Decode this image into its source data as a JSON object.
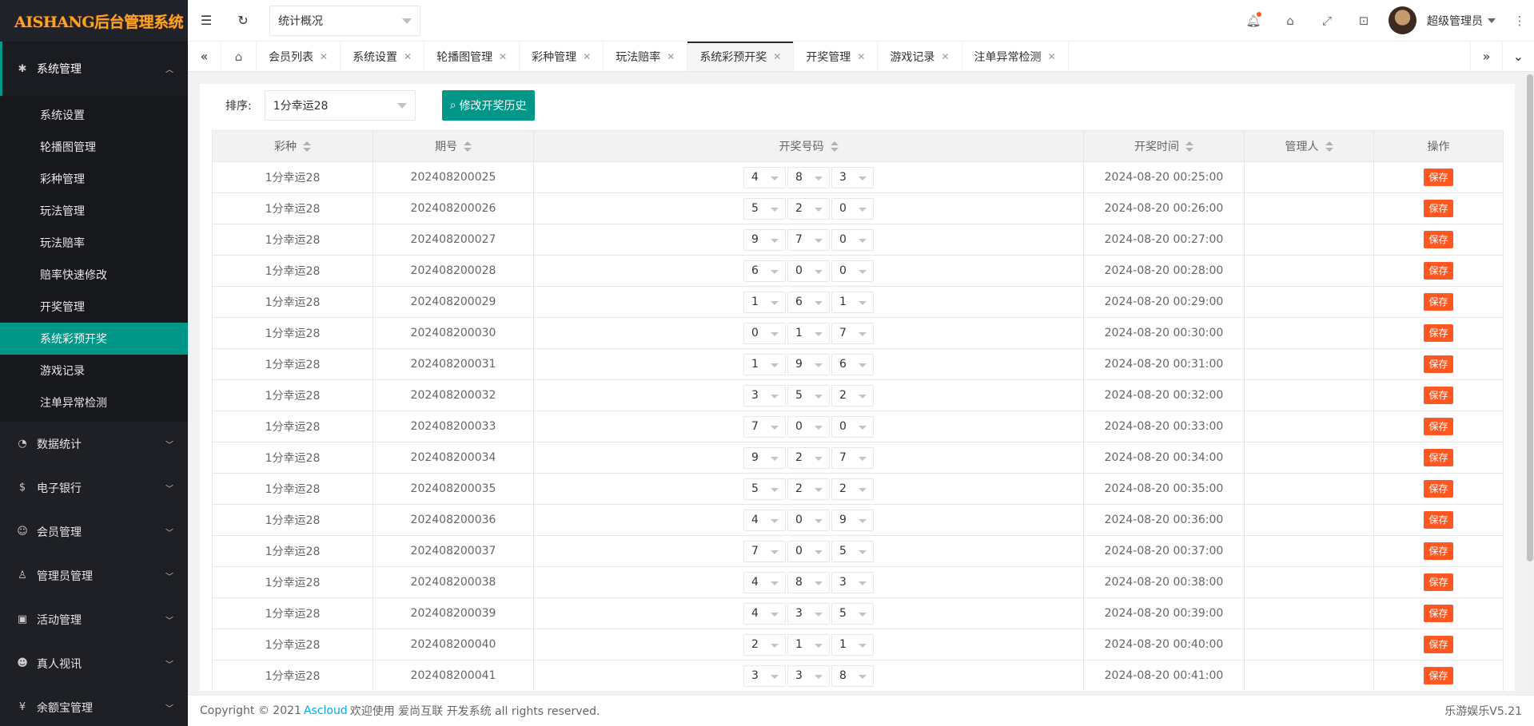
{
  "logo": "AISHANG后台管理系统",
  "sidebar": {
    "open_group": {
      "label": "系统管理",
      "icon": "gear-icon"
    },
    "sub_items": [
      {
        "label": "系统设置",
        "active": false
      },
      {
        "label": "轮播图管理",
        "active": false
      },
      {
        "label": "彩种管理",
        "active": false
      },
      {
        "label": "玩法管理",
        "active": false
      },
      {
        "label": "玩法赔率",
        "active": false
      },
      {
        "label": "赔率快速修改",
        "active": false
      },
      {
        "label": "开奖管理",
        "active": false
      },
      {
        "label": "系统彩预开奖",
        "active": true
      },
      {
        "label": "游戏记录",
        "active": false
      },
      {
        "label": "注单异常检测",
        "active": false
      }
    ],
    "groups": [
      {
        "label": "数据统计",
        "icon": "dashboard-icon"
      },
      {
        "label": "电子银行",
        "icon": "dollar-icon"
      },
      {
        "label": "会员管理",
        "icon": "users-icon"
      },
      {
        "label": "管理员管理",
        "icon": "user-icon"
      },
      {
        "label": "活动管理",
        "icon": "gift-icon"
      },
      {
        "label": "真人视讯",
        "icon": "group-icon"
      },
      {
        "label": "余额宝管理",
        "icon": "coin-icon"
      }
    ]
  },
  "topbar": {
    "select_value": "统计概况",
    "username": "超级管理员"
  },
  "tabs": [
    {
      "label": "会员列表",
      "active": false
    },
    {
      "label": "系统设置",
      "active": false
    },
    {
      "label": "轮播图管理",
      "active": false
    },
    {
      "label": "彩种管理",
      "active": false
    },
    {
      "label": "玩法赔率",
      "active": false
    },
    {
      "label": "系统彩预开奖",
      "active": true
    },
    {
      "label": "开奖管理",
      "active": false
    },
    {
      "label": "游戏记录",
      "active": false
    },
    {
      "label": "注单异常检测",
      "active": false
    }
  ],
  "toolbar": {
    "sort_label": "排序:",
    "sort_value": "1分幸运28",
    "history_button": "修改开奖历史"
  },
  "table": {
    "headers": [
      "彩种",
      "期号",
      "开奖号码",
      "开奖时间",
      "管理人",
      "操作"
    ],
    "save_label": "保存",
    "rows": [
      {
        "lottery": "1分幸运28",
        "issue": "202408200025",
        "nums": [
          "4",
          "8",
          "3"
        ],
        "time": "2024-08-20 00:25:00",
        "admin": ""
      },
      {
        "lottery": "1分幸运28",
        "issue": "202408200026",
        "nums": [
          "5",
          "2",
          "0"
        ],
        "time": "2024-08-20 00:26:00",
        "admin": ""
      },
      {
        "lottery": "1分幸运28",
        "issue": "202408200027",
        "nums": [
          "9",
          "7",
          "0"
        ],
        "time": "2024-08-20 00:27:00",
        "admin": ""
      },
      {
        "lottery": "1分幸运28",
        "issue": "202408200028",
        "nums": [
          "6",
          "0",
          "0"
        ],
        "time": "2024-08-20 00:28:00",
        "admin": ""
      },
      {
        "lottery": "1分幸运28",
        "issue": "202408200029",
        "nums": [
          "1",
          "6",
          "1"
        ],
        "time": "2024-08-20 00:29:00",
        "admin": ""
      },
      {
        "lottery": "1分幸运28",
        "issue": "202408200030",
        "nums": [
          "0",
          "1",
          "7"
        ],
        "time": "2024-08-20 00:30:00",
        "admin": ""
      },
      {
        "lottery": "1分幸运28",
        "issue": "202408200031",
        "nums": [
          "1",
          "9",
          "6"
        ],
        "time": "2024-08-20 00:31:00",
        "admin": ""
      },
      {
        "lottery": "1分幸运28",
        "issue": "202408200032",
        "nums": [
          "3",
          "5",
          "2"
        ],
        "time": "2024-08-20 00:32:00",
        "admin": ""
      },
      {
        "lottery": "1分幸运28",
        "issue": "202408200033",
        "nums": [
          "7",
          "0",
          "0"
        ],
        "time": "2024-08-20 00:33:00",
        "admin": ""
      },
      {
        "lottery": "1分幸运28",
        "issue": "202408200034",
        "nums": [
          "9",
          "2",
          "7"
        ],
        "time": "2024-08-20 00:34:00",
        "admin": ""
      },
      {
        "lottery": "1分幸运28",
        "issue": "202408200035",
        "nums": [
          "5",
          "2",
          "2"
        ],
        "time": "2024-08-20 00:35:00",
        "admin": ""
      },
      {
        "lottery": "1分幸运28",
        "issue": "202408200036",
        "nums": [
          "4",
          "0",
          "9"
        ],
        "time": "2024-08-20 00:36:00",
        "admin": ""
      },
      {
        "lottery": "1分幸运28",
        "issue": "202408200037",
        "nums": [
          "7",
          "0",
          "5"
        ],
        "time": "2024-08-20 00:37:00",
        "admin": ""
      },
      {
        "lottery": "1分幸运28",
        "issue": "202408200038",
        "nums": [
          "4",
          "8",
          "3"
        ],
        "time": "2024-08-20 00:38:00",
        "admin": ""
      },
      {
        "lottery": "1分幸运28",
        "issue": "202408200039",
        "nums": [
          "4",
          "3",
          "5"
        ],
        "time": "2024-08-20 00:39:00",
        "admin": ""
      },
      {
        "lottery": "1分幸运28",
        "issue": "202408200040",
        "nums": [
          "2",
          "1",
          "1"
        ],
        "time": "2024-08-20 00:40:00",
        "admin": ""
      },
      {
        "lottery": "1分幸运28",
        "issue": "202408200041",
        "nums": [
          "3",
          "3",
          "8"
        ],
        "time": "2024-08-20 00:41:00",
        "admin": ""
      }
    ]
  },
  "footer": {
    "prefix": "Copyright © 2021 ",
    "link": "Ascloud",
    "suffix": " 欢迎使用 爱尚互联 开发系统 all rights reserved.",
    "version": "乐游娱乐V5.21"
  },
  "colors": {
    "accent": "#009688",
    "danger": "#ff5722",
    "sidebar": "#1f2025"
  }
}
